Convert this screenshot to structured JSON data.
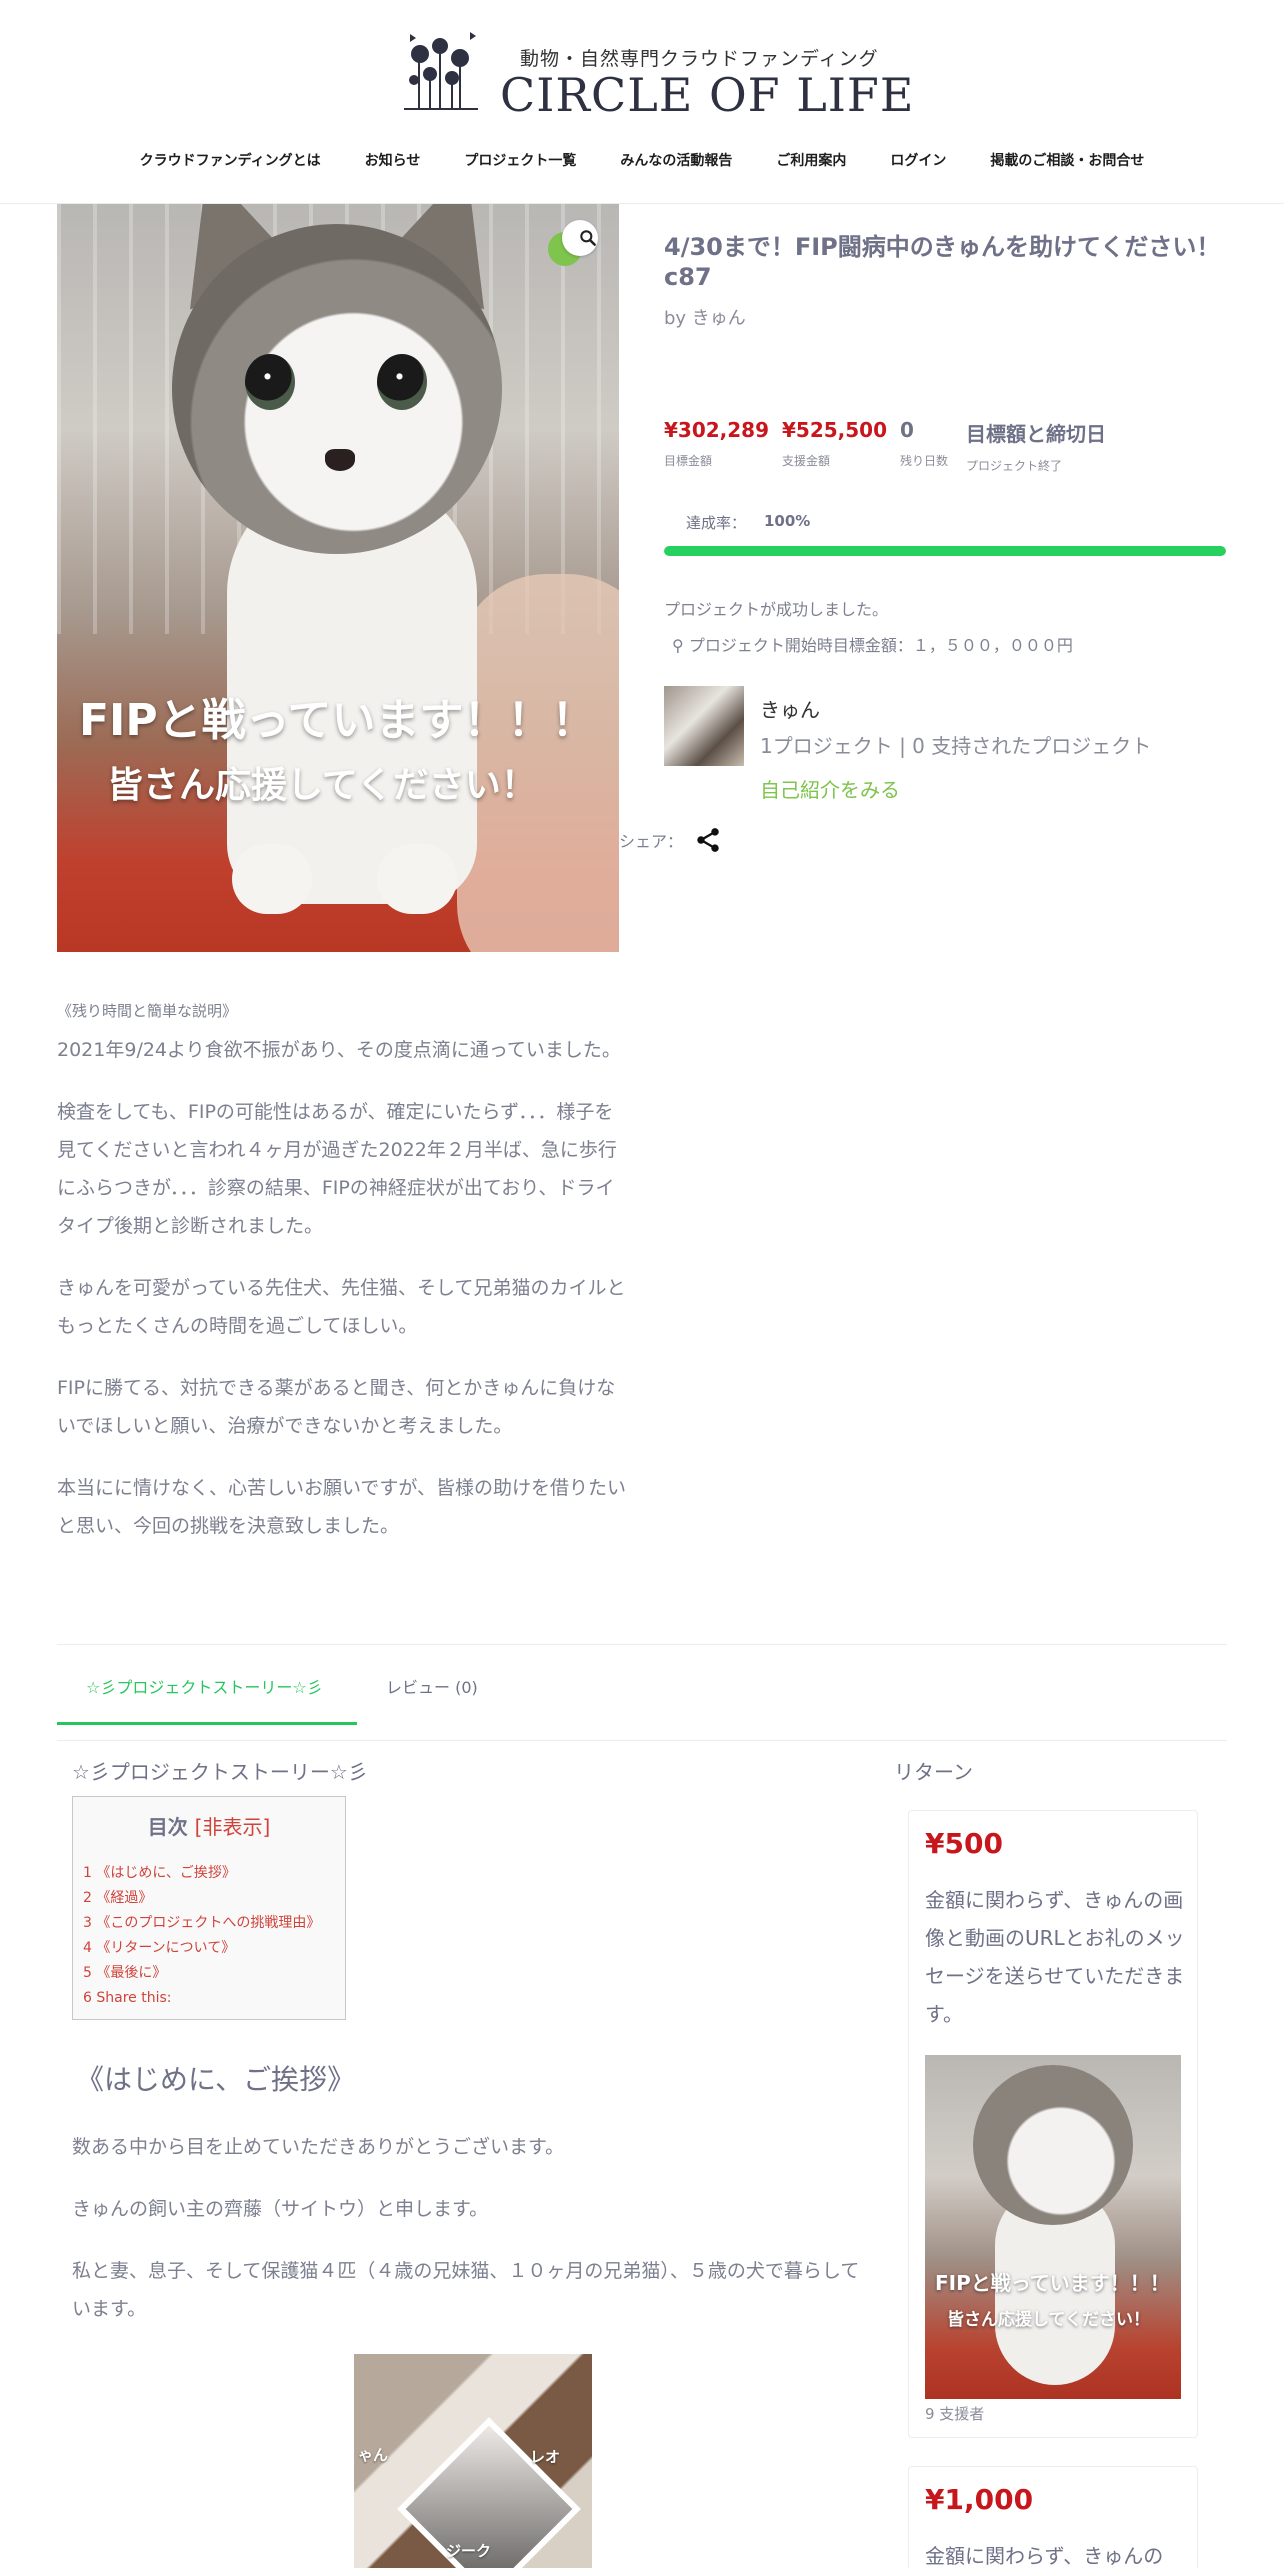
{
  "header": {
    "logo_sub": "動物・自然専門クラウドファンディング",
    "logo_main": "CIRCLE OF LIFE",
    "nav": [
      "クラウドファンディングとは",
      "お知らせ",
      "プロジェクト一覧",
      "みんなの活動報告",
      "ご利用案内",
      "ログイン",
      "掲載のご相談・お問合せ"
    ]
  },
  "hero": {
    "line1": "FIPと戦っています！！！",
    "line2": "皆さん応援してください！",
    "zoom_icon": "search-icon"
  },
  "project": {
    "title": "4/30まで！FIP闘病中のきゅんを助けてください！c87",
    "by": "by きゅん",
    "stats": [
      {
        "value": "¥302,289",
        "label": "目標金額"
      },
      {
        "value": "¥525,500",
        "label": "支援金額"
      },
      {
        "value": "0",
        "label": "残り日数"
      },
      {
        "value": "目標額と締切日",
        "label": "プロジェクト終了"
      }
    ],
    "rate_label": "達成率：",
    "rate_value": "100%",
    "rate_fraction": 1.0,
    "success_text": "プロジェクトが成功しました。",
    "start_goal": "プロジェクト開始時目標金額：１，５００，０００円",
    "owner_name": "きゅん",
    "owner_meta": "1プロジェクト | 0 支持されたプロジェクト",
    "owner_link": "自己紹介をみる",
    "share_label": "シェア："
  },
  "description": {
    "heading": "《残り時間と簡単な説明》",
    "paragraphs": [
      "2021年9/24より食欲不振があり、その度点滴に通っていました。",
      "検査をしても、FIPの可能性はあるが、確定にいたらず．．．様子を見てくださいと言われ４ヶ月が過ぎた2022年２月半ば、急に歩行にふらつきが．．．診察の結果、FIPの神経症状が出ており、ドライタイプ後期と診断されました。",
      "きゅんを可愛がっている先住犬、先住猫、そして兄弟猫のカイルともっとたくさんの時間を過ごしてほしい。",
      "FIPに勝てる、対抗できる薬があると聞き、何とかきゅんに負けないでほしいと願い、治療ができないかと考えました。",
      "本当にに情けなく、心苦しいお願いですが、皆様の助けを借りたいと思い、今回の挑戦を決意致しました。"
    ]
  },
  "tabs": {
    "story": "☆彡プロジェクトストーリー☆彡",
    "reviews": "レビュー (0)"
  },
  "story": {
    "title": "☆彡プロジェクトストーリー☆彡",
    "toc_title": "目次",
    "toc_hide": "非表示",
    "toc_items": [
      "1 《はじめに、ご挨拶》",
      "2 《経過》",
      "3 《このプロジェクトへの挑戦理由》",
      "4 《リターンについて》",
      "5 《最後に》",
      "6 Share this:"
    ],
    "section_title": "《はじめに、ご挨拶》",
    "p1": "数ある中から目を止めていただきありがとうございます。",
    "p2": "きゅんの飼い主の齊藤（サイトウ）と申します。",
    "p3": "私と妻、息子、そして保護猫４匹（４歳の兄妹猫、１０ヶ月の兄弟猫）、５歳の犬で暮らしています。",
    "collage_labels": [
      "ゃん",
      "レオ",
      "ジーク"
    ]
  },
  "returns": {
    "title": "リターン",
    "cards": [
      {
        "price": "¥500",
        "text": "金額に関わらず、きゅんの画像と動画のURLとお礼のメッセージを送らせていただきます。",
        "img_line1": "FIPと戦っています！！！",
        "img_line2": "皆さん応援してください！",
        "backers": "9 支援者"
      },
      {
        "price": "¥1,000",
        "text": "金額に関わらず、きゅんの"
      }
    ]
  },
  "colors": {
    "accent_green": "#27c65c",
    "link_green": "#7ec44d",
    "price_red": "#c8161d",
    "toc_red": "#d0433b"
  }
}
